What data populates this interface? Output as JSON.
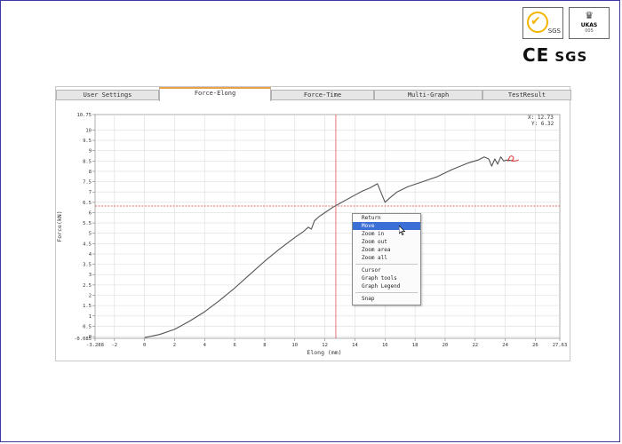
{
  "badges": {
    "sgs_emblem_text": "SGS",
    "ukas_text": "UKAS",
    "ukas_sub": "MANAGEMENT\nSYSTEMS",
    "ukas_code": "005",
    "ce_mark": "CE",
    "sgs_mark": "SGS"
  },
  "tabs": [
    {
      "label": "User Settings",
      "active": false
    },
    {
      "label": "Force-Elong",
      "active": true
    },
    {
      "label": "Force-Time",
      "active": false
    },
    {
      "label": "Multi-Graph",
      "active": false
    },
    {
      "label": "TestResult",
      "active": false
    }
  ],
  "readout": {
    "x": "X: 12.73",
    "y": "Y: 6.32"
  },
  "context_menu": {
    "items": [
      "Return",
      "Move",
      "Zoom in",
      "Zoom out",
      "Zoom area",
      "Zoom all",
      "Cursor",
      "Graph tools",
      "Graph Legend",
      "Snap"
    ],
    "selected": "Move"
  },
  "colors": {
    "curve": "#555555",
    "crosshair": "#e03c3c",
    "grid": "#dcdcdc",
    "menu_highlight": "#3b6fd6",
    "tab_active_accent": "#e8a24a",
    "failure_marker": "#e03c3c"
  },
  "chart_data": {
    "type": "line",
    "title": "",
    "xlabel": "Elong (mm)",
    "ylabel": "Force(kN)",
    "xlim": [
      -3.288,
      27.63
    ],
    "ylim": [
      -0.085,
      10.75
    ],
    "x_ticks": [
      "-3.288",
      "-2",
      "0",
      "2",
      "4",
      "6",
      "8",
      "10",
      "12",
      "14",
      "16",
      "18",
      "20",
      "22",
      "24",
      "26",
      "27.63"
    ],
    "y_ticks": [
      "-0.085",
      "0",
      "0.5",
      "1",
      "1.5",
      "2",
      "2.5",
      "3",
      "3.5",
      "4",
      "4.5",
      "5",
      "5.5",
      "6",
      "6.5",
      "7",
      "7.5",
      "8",
      "8.5",
      "9",
      "9.5",
      "10",
      "10.75"
    ],
    "grid": true,
    "crosshair": {
      "x": 12.73,
      "y": 6.32
    },
    "series": [
      {
        "x": [
          0.0,
          1.0,
          2.0,
          3.0,
          4.0,
          5.0,
          6.0,
          7.0,
          8.0,
          9.0,
          10.0,
          10.6,
          10.9,
          11.1,
          11.3,
          11.6,
          12.0,
          12.5,
          13.0,
          14.0,
          14.5,
          15.0,
          15.5,
          16.0,
          16.3,
          16.8,
          17.5,
          18.5,
          19.5,
          20.5,
          21.5,
          22.2,
          22.6,
          22.9,
          23.1,
          23.3,
          23.5,
          23.7,
          23.9,
          24.1,
          24.6
        ],
        "y": [
          -0.05,
          0.1,
          0.35,
          0.75,
          1.2,
          1.75,
          2.35,
          3.0,
          3.65,
          4.25,
          4.8,
          5.1,
          5.3,
          5.2,
          5.6,
          5.8,
          6.0,
          6.25,
          6.45,
          6.85,
          7.05,
          7.2,
          7.4,
          6.5,
          6.7,
          7.0,
          7.25,
          7.5,
          7.75,
          8.1,
          8.4,
          8.55,
          8.7,
          8.6,
          8.25,
          8.6,
          8.35,
          8.7,
          8.5,
          8.55,
          8.5
        ],
        "values": [
          -0.05,
          0.1,
          0.35,
          0.75,
          1.2,
          1.75,
          2.35,
          3.0,
          3.65,
          4.25,
          4.8,
          5.1,
          5.3,
          5.2,
          5.6,
          5.8,
          6.0,
          6.25,
          6.45,
          6.85,
          7.05,
          7.2,
          7.4,
          6.5,
          6.7,
          7.0,
          7.25,
          7.5,
          7.75,
          8.1,
          8.4,
          8.55,
          8.7,
          8.6,
          8.25,
          8.6,
          8.35,
          8.7,
          8.5,
          8.55,
          8.5
        ]
      }
    ],
    "failure_marker": {
      "x": 24.3,
      "y": 8.6
    }
  }
}
